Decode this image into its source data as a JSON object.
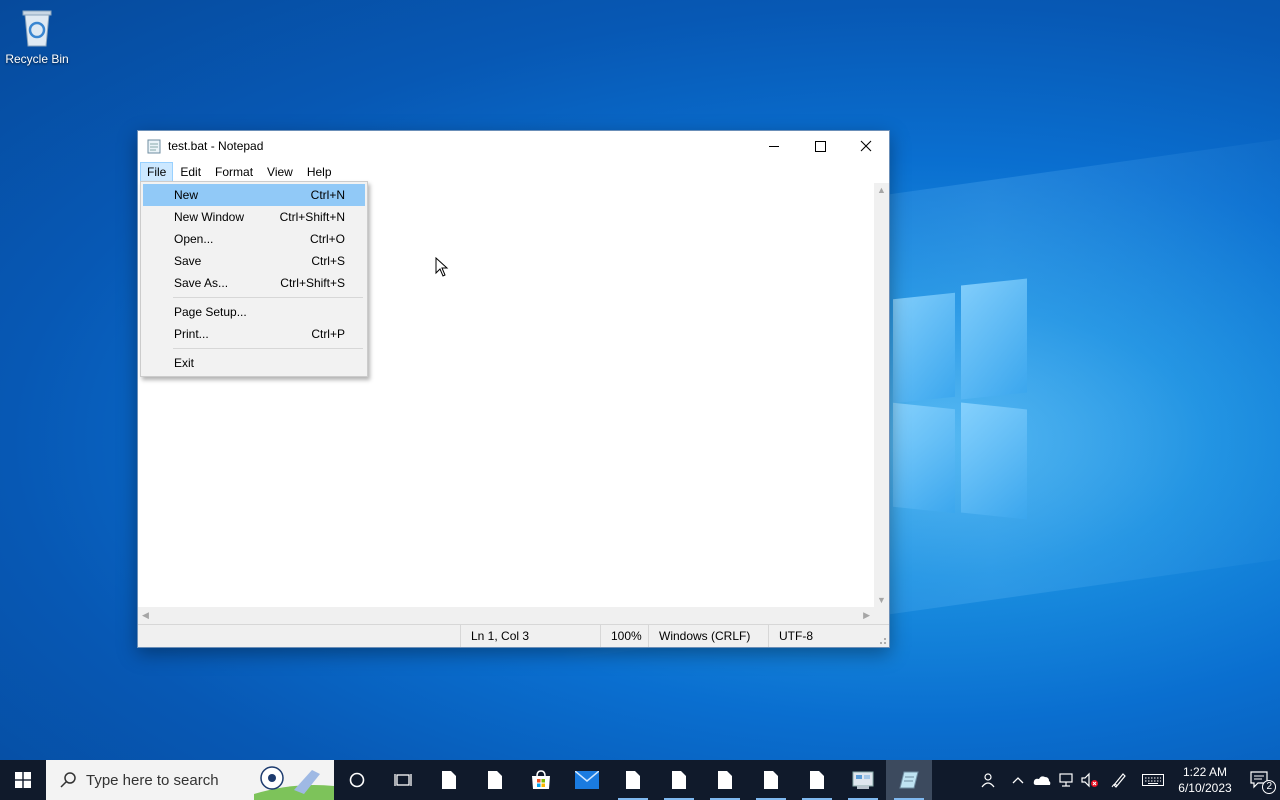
{
  "desktop": {
    "recycle_bin_label": "Recycle Bin"
  },
  "window": {
    "title": "test.bat - Notepad",
    "menu": [
      "File",
      "Edit",
      "Format",
      "View",
      "Help"
    ],
    "file_menu": {
      "items": [
        {
          "label": "New",
          "accel": "Ctrl+N"
        },
        {
          "label": "New Window",
          "accel": "Ctrl+Shift+N"
        },
        {
          "label": "Open...",
          "accel": "Ctrl+O"
        },
        {
          "label": "Save",
          "accel": "Ctrl+S"
        },
        {
          "label": "Save As...",
          "accel": "Ctrl+Shift+S"
        },
        {
          "label": "Page Setup...",
          "accel": ""
        },
        {
          "label": "Print...",
          "accel": "Ctrl+P"
        },
        {
          "label": "Exit",
          "accel": ""
        }
      ]
    },
    "status": {
      "position": "Ln 1, Col 3",
      "zoom": "100%",
      "line_ending": "Windows (CRLF)",
      "encoding": "UTF-8"
    }
  },
  "taskbar": {
    "search_placeholder": "Type here to search",
    "clock_time": "1:22 AM",
    "clock_date": "6/10/2023",
    "notification_count": "2"
  },
  "colors": {
    "menu_highlight": "#91c9f7",
    "taskbar_bg": "#101a2b",
    "accent_underline": "#7fb8ef"
  }
}
